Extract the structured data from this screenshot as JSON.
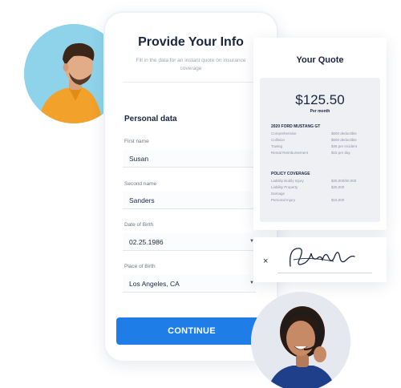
{
  "form": {
    "title": "Provide Your Info",
    "subtitle": "Fill in the data for an instant quote on insurance coverage",
    "section_title": "Personal data",
    "fields": [
      {
        "label": "First name",
        "value": "Susan"
      },
      {
        "label": "Second name",
        "value": "Sanders"
      },
      {
        "label": "Date of Birth",
        "value": "02.25.1986"
      },
      {
        "label": "Place of Birth",
        "value": "Los Angeles, CA"
      }
    ],
    "continue_label": "CONTINUE"
  },
  "quote": {
    "title": "Your Quote",
    "price": "$125.50",
    "period": "Per month",
    "vehicle": {
      "title": "2020 FORD MUSTANG GT",
      "rows": [
        {
          "name": "Comprehensive",
          "value": "$500 deductible"
        },
        {
          "name": "Collision",
          "value": "$500 deductible"
        },
        {
          "name": "Towing",
          "value": "$35 per incident"
        },
        {
          "name": "Rental Reimbursement",
          "value": "$15 per day"
        }
      ]
    },
    "policy": {
      "title": "POLICY COVERAGE",
      "rows": [
        {
          "name": "Liability Bodily Injury",
          "value": "$25,000/50,000"
        },
        {
          "name": "Liability Property",
          "value": "$25,000"
        },
        {
          "name": "Damage",
          "value": ""
        },
        {
          "name": "Personal Injury",
          "value": "$15,000"
        }
      ]
    }
  },
  "signature": {
    "mark": "×"
  },
  "colors": {
    "accent": "#1e7de6",
    "heading": "#1a2540",
    "man_bg": "#8fd3ea",
    "shirt": "#f2a12a"
  },
  "icons": {
    "dropdown": "caret-down-icon",
    "signature": "handwritten-signature"
  }
}
